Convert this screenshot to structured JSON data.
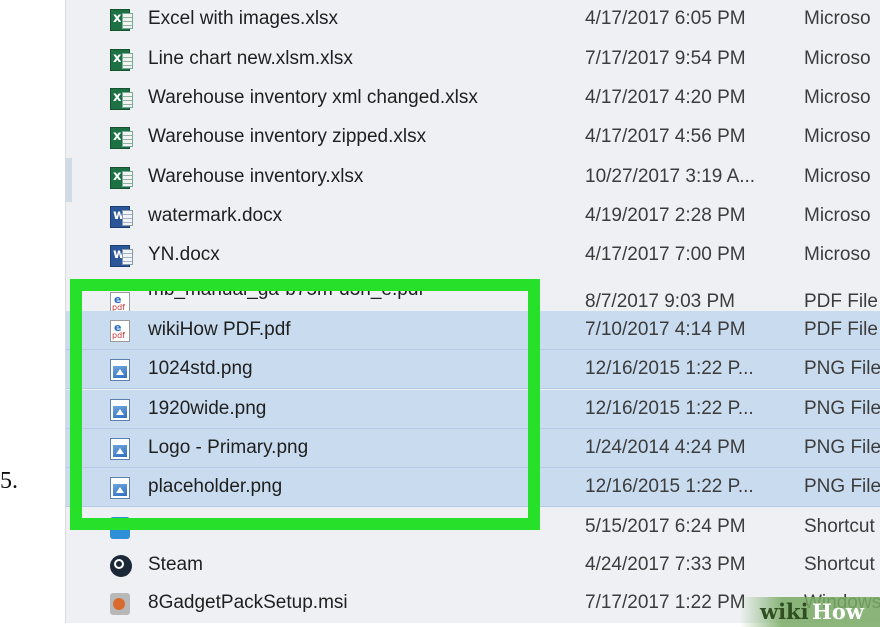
{
  "step_number": "5.",
  "files": [
    {
      "name": "Excel with images.xlsx",
      "date": "4/17/2017 6:05 PM",
      "type": "Microso",
      "icon": "excel-icon",
      "selected": false
    },
    {
      "name": "Line chart new.xlsm.xlsx",
      "date": "7/17/2017 9:54 PM",
      "type": "Microso",
      "icon": "excel-icon",
      "selected": false
    },
    {
      "name": "Warehouse inventory xml changed.xlsx",
      "date": "4/17/2017 4:20 PM",
      "type": "Microso",
      "icon": "excel-icon",
      "selected": false
    },
    {
      "name": "Warehouse inventory zipped.xlsx",
      "date": "4/17/2017 4:56 PM",
      "type": "Microso",
      "icon": "excel-icon",
      "selected": false
    },
    {
      "name": "Warehouse inventory.xlsx",
      "date": "10/27/2017 3:19 A...",
      "type": "Microso",
      "icon": "excel-icon",
      "selected": false
    },
    {
      "name": "watermark.docx",
      "date": "4/19/2017 2:28 PM",
      "type": "Microso",
      "icon": "word-icon",
      "selected": false
    },
    {
      "name": "YN.docx",
      "date": "4/17/2017 7:00 PM",
      "type": "Microso",
      "icon": "word-icon",
      "selected": false
    },
    {
      "name": "mb_manual_ga-b75m-d3h_e.pdf",
      "date": "8/7/2017 9:03 PM",
      "type": "PDF File",
      "icon": "pdf-icon",
      "selected": false
    },
    {
      "name": "wikiHow PDF.pdf",
      "date": "7/10/2017 4:14 PM",
      "type": "PDF File",
      "icon": "pdf-icon",
      "selected": true
    },
    {
      "name": "1024std.png",
      "date": "12/16/2015 1:22 P...",
      "type": "PNG File",
      "icon": "image-icon",
      "selected": true
    },
    {
      "name": "1920wide.png",
      "date": "12/16/2015 1:22 P...",
      "type": "PNG File",
      "icon": "image-icon",
      "selected": true
    },
    {
      "name": "Logo - Primary.png",
      "date": "1/24/2014 4:24 PM",
      "type": "PNG File",
      "icon": "image-icon",
      "selected": true
    },
    {
      "name": "placeholder.png",
      "date": "12/16/2015 1:22 P...",
      "type": "PNG File",
      "icon": "image-icon",
      "selected": true
    },
    {
      "name": "",
      "date": "5/15/2017 6:24 PM",
      "type": "Shortcut",
      "icon": "shortcut-icon",
      "selected": false
    },
    {
      "name": "Steam",
      "date": "4/24/2017 7:33 PM",
      "type": "Shortcut",
      "icon": "steam-icon",
      "selected": false
    },
    {
      "name": "8GadgetPackSetup.msi",
      "date": "7/17/2017 1:22 PM",
      "type": "Windows",
      "icon": "installer-icon",
      "selected": false
    }
  ],
  "watermark": {
    "part1": "wiki",
    "part2": "How"
  },
  "colors": {
    "highlight": "#27e02a",
    "selection": "#c9dcef"
  }
}
